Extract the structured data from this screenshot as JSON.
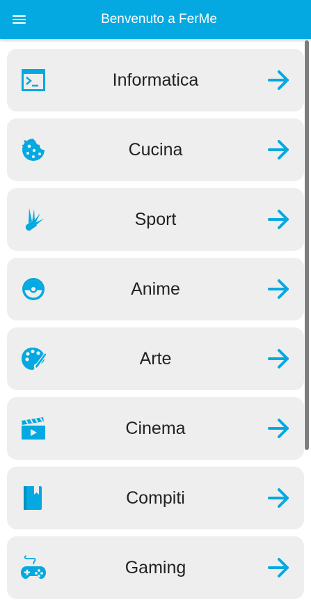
{
  "app": {
    "title": "Benvenuto a FerMe",
    "accent_color": "#03a9e0",
    "menu_icon": "hamburger-menu-icon"
  },
  "categories": [
    {
      "label": "Informatica",
      "icon": "terminal-icon"
    },
    {
      "label": "Cucina",
      "icon": "cookie-icon"
    },
    {
      "label": "Sport",
      "icon": "shuttlecock-icon"
    },
    {
      "label": "Anime",
      "icon": "pokeball-icon"
    },
    {
      "label": "Arte",
      "icon": "palette-icon"
    },
    {
      "label": "Cinema",
      "icon": "clapperboard-icon"
    },
    {
      "label": "Compiti",
      "icon": "book-icon"
    },
    {
      "label": "Gaming",
      "icon": "gamepad-icon"
    }
  ],
  "arrow_icon": "arrow-right-icon"
}
